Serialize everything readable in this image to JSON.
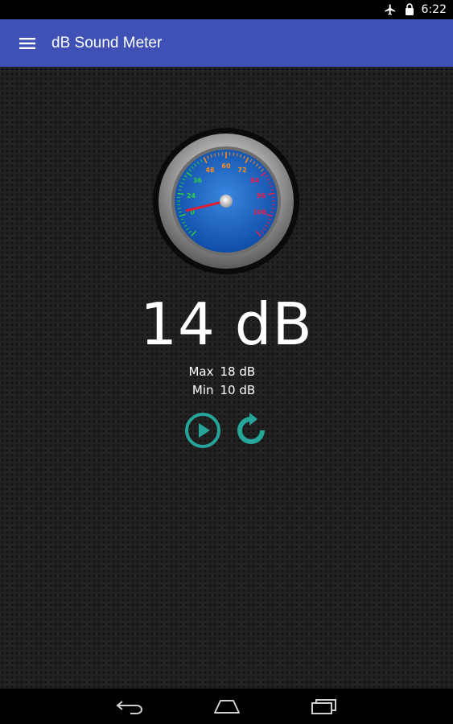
{
  "status_bar": {
    "time": "6:22",
    "icons": [
      "airplane-icon",
      "lock-battery-icon"
    ]
  },
  "app_bar": {
    "title": "dB Sound Meter",
    "menu_icon": "hamburger-menu-icon",
    "color": "#3f51b5"
  },
  "gauge": {
    "value_db": 14,
    "min": 0,
    "max": 120,
    "tick_labels": [
      "0",
      "24",
      "36",
      "48",
      "60",
      "72",
      "84",
      "96",
      "108"
    ],
    "needle_color": "#e41b2c",
    "face_color": "#1565c0"
  },
  "reading": {
    "text": "14 dB"
  },
  "stats": {
    "max_label": "Max",
    "max_value": "18 dB",
    "min_label": "Min",
    "min_value": "10 dB"
  },
  "controls": {
    "play_icon": "play-icon",
    "reset_icon": "refresh-icon",
    "accent": "#26a69a"
  },
  "nav_bar": {
    "icons": [
      "back-icon",
      "home-icon",
      "recent-apps-icon"
    ]
  }
}
